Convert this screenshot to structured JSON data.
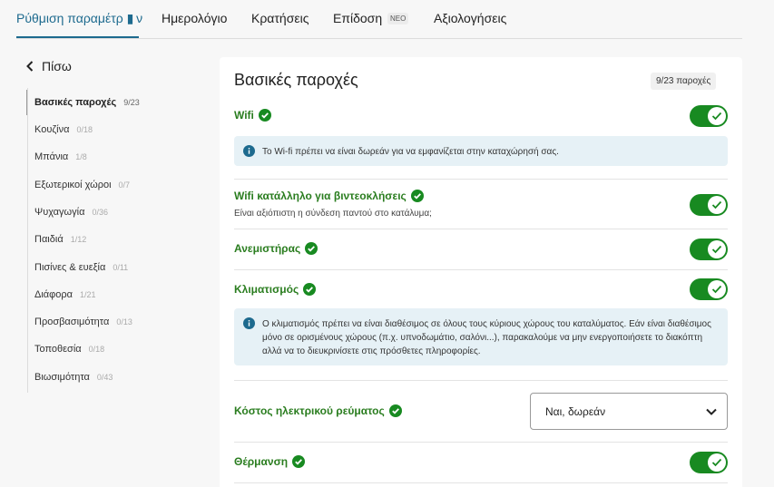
{
  "nav": {
    "tabs": [
      {
        "label": "Ρύθμιση παραμέτρ ▮ ν"
      },
      {
        "label": "Ημερολόγιο"
      },
      {
        "label": "Κρατήσεις"
      },
      {
        "label": "Επίδοση"
      },
      {
        "label": "Αξιολογήσεις"
      }
    ],
    "new_badge": "ΝΕΟ"
  },
  "sidebar": {
    "back_label": "Πίσω",
    "items": [
      {
        "label": "Βασικές παροχές",
        "count": "9/23"
      },
      {
        "label": "Κουζίνα",
        "count": "0/18"
      },
      {
        "label": "Μπάνια",
        "count": "1/8"
      },
      {
        "label": "Εξωτερικοί χώροι",
        "count": "0/7"
      },
      {
        "label": "Ψυχαγωγία",
        "count": "0/36"
      },
      {
        "label": "Παιδιά",
        "count": "1/12"
      },
      {
        "label": "Πισίνες & ευεξία",
        "count": "0/11"
      },
      {
        "label": "Διάφορα",
        "count": "1/21"
      },
      {
        "label": "Προσβασιμότητα",
        "count": "0/13"
      },
      {
        "label": "Τοποθεσία",
        "count": "0/18"
      },
      {
        "label": "Βιωσιμότητα",
        "count": "0/43"
      }
    ]
  },
  "main": {
    "title": "Βασικές παροχές",
    "count_badge": "9/23 παροχές",
    "rows": {
      "wifi": {
        "label": "Wifi",
        "enabled": true
      },
      "wifi_info": "Το Wi-fi πρέπει να είναι δωρεάν για να εμφανίζεται στην καταχώρησή σας.",
      "wifi_video": {
        "label": "Wifi κατάλληλο για βιντεοκλήσεις",
        "sub": "Είναι αξιόπιστη η σύνδεση παντού στο κατάλυμα;",
        "enabled": true
      },
      "fan": {
        "label": "Ανεμιστήρας",
        "enabled": true
      },
      "ac": {
        "label": "Κλιματισμός",
        "enabled": true
      },
      "ac_info": "Ο κλιματισμός πρέπει να είναι διαθέσιμος σε όλους τους κύριους χώρους του καταλύματος. Εάν είναι διαθέσιμος μόνο σε ορισμένους χώρους (π.χ. υπνοδωμάτιο, σαλόνι...), παρακαλούμε να μην ενεργοποιήσετε το διακόπτη αλλά να το διευκρινίσετε στις πρόσθετες πληροφορίες.",
      "electricity": {
        "label": "Κόστος ηλεκτρικού ρεύματος",
        "selected": "Ναι, δωρεάν"
      },
      "heating": {
        "label": "Θέρμανση",
        "enabled": true
      }
    }
  },
  "colors": {
    "accent": "#1d6a8e",
    "green": "#188a21",
    "label_green": "#2a7d1f",
    "info_bg": "#e6f1f6"
  }
}
